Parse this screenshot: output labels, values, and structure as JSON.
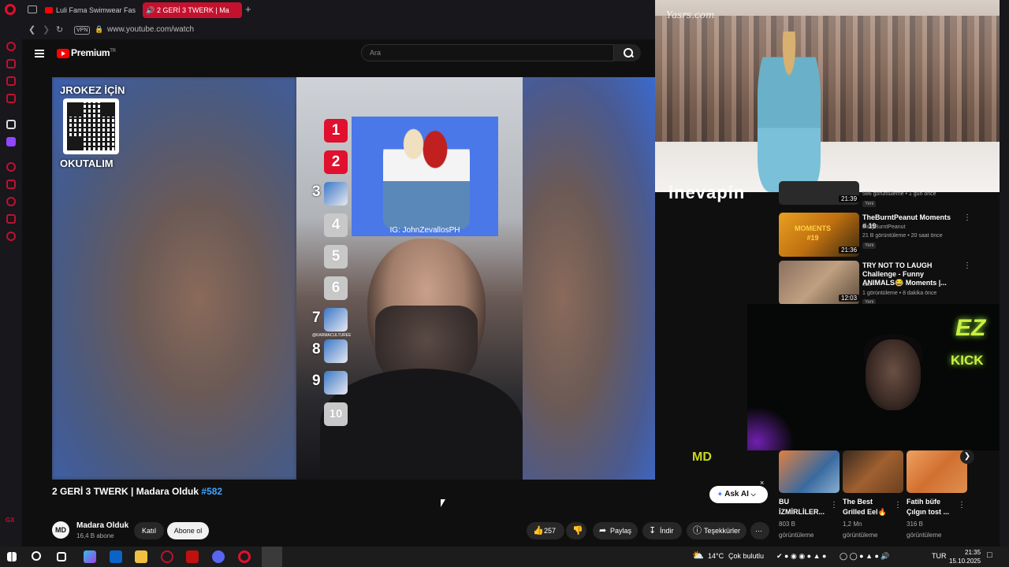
{
  "browser": {
    "tabs": [
      {
        "label": "Luli Fama Swimwear Fas"
      },
      {
        "label": "2 GERİ 3 TWERK | Ma"
      }
    ],
    "vpn_label": "VPN",
    "url": "www.youtube.com/watch",
    "sidebar_gx": "GX"
  },
  "youtube": {
    "logo_text": "Premium",
    "logo_region": "TR",
    "search_placeholder": "Ara"
  },
  "video": {
    "overlay_top": "JROKEZ İÇİN",
    "overlay_bottom": "OKUTALIM",
    "ranking": [
      "1",
      "2",
      "3",
      "4",
      "5",
      "6",
      "7",
      "8",
      "9",
      "10"
    ],
    "sticker_caption": "IG: JohnZevallosPH",
    "karma_tag": "@KARMACULTUREE",
    "watermark": "MD",
    "title": "2 GERİ 3 TWERK | Madara Olduk",
    "title_hashtag": "#582"
  },
  "ask_ai": {
    "label": "Ask AI",
    "close": "×"
  },
  "channel": {
    "avatar_text": "MD",
    "name": "Madara Olduk",
    "subscribers": "16,4 B abone",
    "join_label": "Katıl",
    "subscribe_label": "Abone ol"
  },
  "actions": {
    "like_count": "257",
    "share": "Paylaş",
    "download": "İndir",
    "thanks": "Teşekkürler",
    "more": "⋯"
  },
  "pip": {
    "watermark": "Yasrs.com",
    "overlay_brand": "inevapin"
  },
  "recommendations": [
    {
      "duration": "21:39",
      "meta": "586 görüntüleme • 1 gün önce",
      "badge": "Yeni"
    },
    {
      "title": "TheBurntPeanut Moments # 19",
      "channel": "DailyBurntPeanut",
      "meta": "21 B görüntüleme • 20 saat önce",
      "badge": "Yeni",
      "duration": "21:36",
      "thumb_text": "MOMENTS #19"
    },
    {
      "title": "TRY NOT TO LAUGH Challenge - Funny ANIMALS😂 Moments |...",
      "channel": "cati",
      "meta": "1 görüntüleme • 8 dakika önce",
      "badge": "Yeni",
      "duration": "12:03"
    }
  ],
  "streamer": {
    "logo_top": "EZ",
    "logo_bottom": "KICK"
  },
  "shelf": [
    {
      "title": "BU İZMİRLİLER...",
      "views": "803 B",
      "views_label": "görüntüleme"
    },
    {
      "title": "The Best Grilled Eel🔥",
      "views": "1,2 Mn",
      "views_label": "görüntüleme"
    },
    {
      "title": "Fatih büfe Çılgın tost ...",
      "views": "316 B",
      "views_label": "görüntüleme"
    }
  ],
  "taskbar": {
    "temperature": "14°C",
    "weather": "Çok bulutlu",
    "language": "TUR",
    "time": "21:35",
    "date": "15.10.2025"
  },
  "colors": {
    "accent": "#e0102e",
    "youtube_red": "#ff0000",
    "link": "#3ea6ff",
    "kick_green": "#ccf040"
  }
}
